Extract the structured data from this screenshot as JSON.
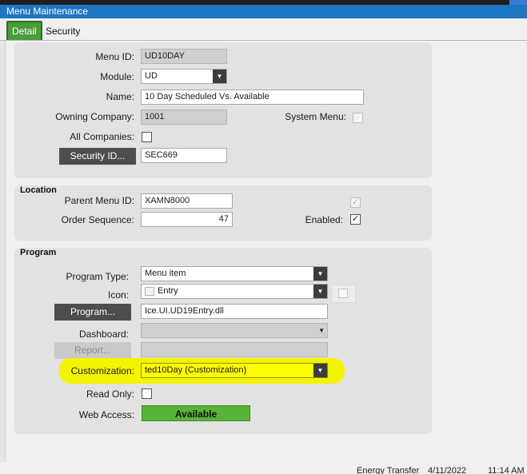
{
  "window": {
    "title": "Menu Maintenance"
  },
  "tabs": [
    {
      "label": "Detail",
      "active": true
    },
    {
      "label": "Security",
      "active": false
    }
  ],
  "detail": {
    "menu_id": {
      "label": "Menu ID:",
      "value": "UD10DAY"
    },
    "module": {
      "label": "Module:",
      "value": "UD"
    },
    "name": {
      "label": "Name:",
      "value": "10 Day Scheduled Vs. Available"
    },
    "owning_company": {
      "label": "Owning Company:",
      "value": "1001"
    },
    "system_menu": {
      "label": "System Menu:",
      "checked": false
    },
    "all_companies": {
      "label": "All Companies:",
      "checked": false
    },
    "security_id": {
      "button_label": "Security ID...",
      "value": "SEC669"
    }
  },
  "location": {
    "title": "Location",
    "parent_menu_id": {
      "label": "Parent Menu ID:",
      "value": "XAMN8000"
    },
    "order_sequence": {
      "label": "Order Sequence:",
      "value": "47"
    },
    "enabled": {
      "label": "Enabled:",
      "checked": true
    }
  },
  "program": {
    "title": "Program",
    "program_type": {
      "label": "Program Type:",
      "value": "Menu item"
    },
    "icon": {
      "label": "Icon:",
      "value": "Entry"
    },
    "program": {
      "button_label": "Program...",
      "value": "Ice.UI.UD19Entry.dll"
    },
    "dashboard": {
      "label": "Dashboard:",
      "value": ""
    },
    "report": {
      "button_label": "Report...",
      "value": ""
    },
    "customization": {
      "label": "Customization:",
      "value": "ted10Day (Customization)"
    },
    "read_only": {
      "label": "Read Only:",
      "checked": false
    },
    "web_access": {
      "label": "Web Access:",
      "value": "Available"
    }
  },
  "status_bar": {
    "company": "Energy Transfer",
    "date": "4/11/2022",
    "time": "11:14 AM"
  },
  "colors": {
    "title_bar": "#1f76c2",
    "active_tab": "#4a9b3b",
    "highlight": "#f3f500",
    "web_access_badge": "#58b33a"
  }
}
